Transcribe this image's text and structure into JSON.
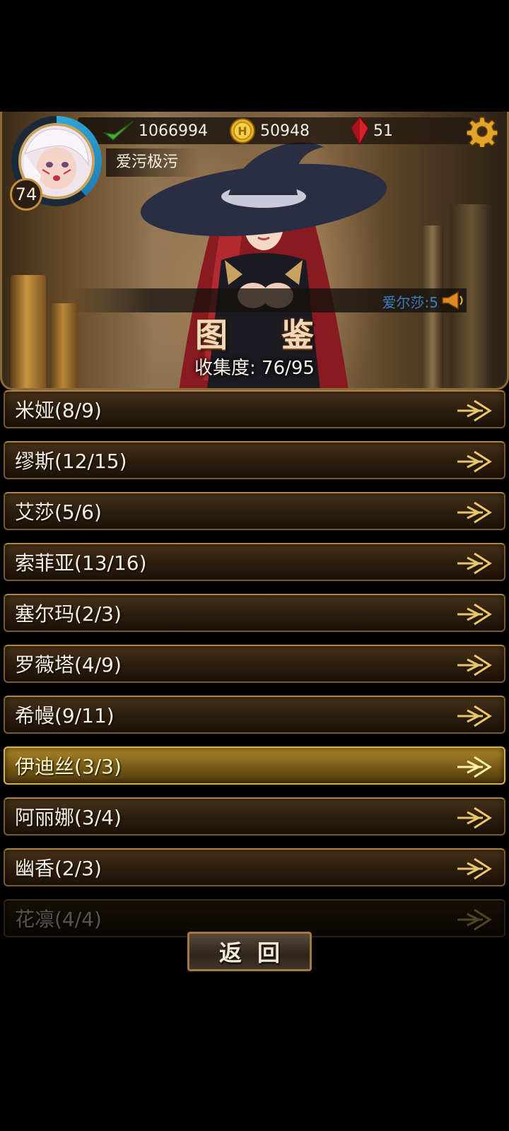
{
  "header": {
    "player": {
      "level": "74",
      "name": "爱污极污"
    },
    "resources": {
      "power": "1066994",
      "gold": "50948",
      "gems": "51"
    },
    "marquee_text": "爱尔莎:5",
    "title": "图 鉴",
    "collection_label": "收集度: 76/95"
  },
  "list": {
    "items": [
      {
        "label": "米娅(8/9)"
      },
      {
        "label": "缪斯(12/15)"
      },
      {
        "label": "艾莎(5/6)"
      },
      {
        "label": "索菲亚(13/16)"
      },
      {
        "label": "塞尔玛(2/3)"
      },
      {
        "label": "罗薇塔(4/9)"
      },
      {
        "label": "希幔(9/11)"
      },
      {
        "label": "伊迪丝(3/3)"
      },
      {
        "label": "阿丽娜(3/4)"
      },
      {
        "label": "幽香(2/3)"
      },
      {
        "label": "花凛(4/4)"
      }
    ]
  },
  "footer": {
    "back_label": "返回"
  },
  "colors": {
    "accent_gold": "#c9933f",
    "highlight_row": "#b08a2a",
    "marquee_blue": "#3b7fc4"
  }
}
